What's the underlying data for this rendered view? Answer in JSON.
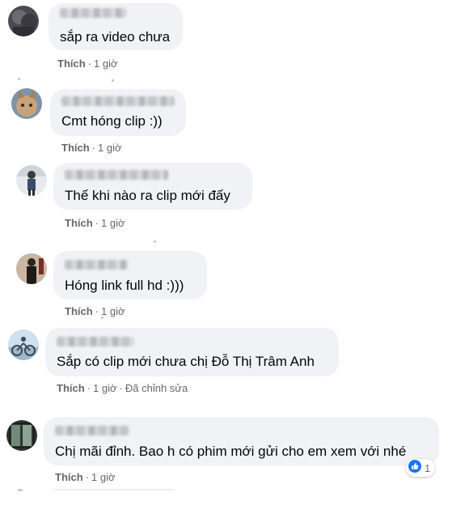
{
  "comments": [
    {
      "text": "sắp ra video chưa",
      "like": "Thích",
      "time": "1 giờ",
      "edited": ""
    },
    {
      "text": "Cmt hóng clip :))",
      "like": "Thích",
      "time": "1 giờ",
      "edited": ""
    },
    {
      "text": "Thế khi nào ra clip mới đấy",
      "like": "Thích",
      "time": "1 giờ",
      "edited": ""
    },
    {
      "text": "Hóng link full hd :)))",
      "like": "Thích",
      "time": "1 giờ",
      "edited": ""
    },
    {
      "text": "Sắp có clip mới chưa chị Đỗ Thị Trâm Anh",
      "like": "Thích",
      "time": "1 giờ",
      "edited": "Đã chỉnh sửa"
    },
    {
      "text": "Chị mãi đỉnh. Bao h có phim mới gửi cho em xem với nhé",
      "like": "Thích",
      "time": "1 giờ",
      "edited": ""
    }
  ],
  "reactions": {
    "icon": "like-icon",
    "count": "1",
    "color": "#1877f2"
  },
  "colors": {
    "bubble": "#f0f2f5",
    "meta": "#65676b",
    "text": "#050505"
  }
}
